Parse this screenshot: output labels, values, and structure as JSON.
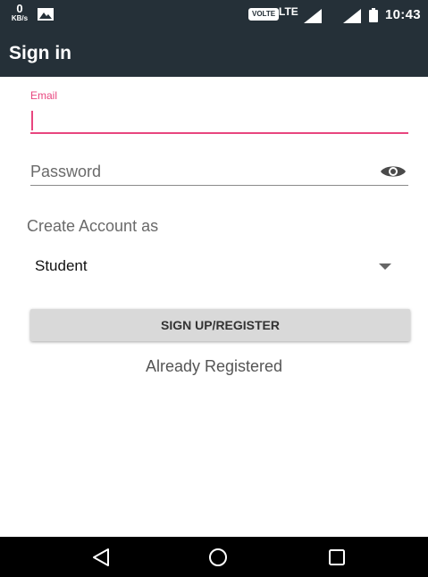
{
  "status_bar": {
    "kb_value": "0",
    "kb_unit": "KB/s",
    "volte": "VOLTE",
    "network": "LTE",
    "time": "10:43",
    "icons": [
      "image-notification-icon",
      "signal-icon",
      "signal-icon",
      "battery-icon"
    ]
  },
  "app_bar": {
    "title": "Sign in"
  },
  "form": {
    "email_label": "Email",
    "email_value": "",
    "password_placeholder": "Password",
    "password_toggle_icon": "eye-icon",
    "create_account_label": "Create Account as",
    "account_type": "Student",
    "register_label": "SIGN UP/REGISTER",
    "already_registered": "Already Registered"
  },
  "colors": {
    "primary_dark": "#253038",
    "accent": "#e8467f",
    "button_bg": "#d9d9d9",
    "nav_bar": "#000000"
  },
  "nav_bar": {
    "icons": [
      "back-icon",
      "home-icon",
      "recents-icon"
    ]
  }
}
